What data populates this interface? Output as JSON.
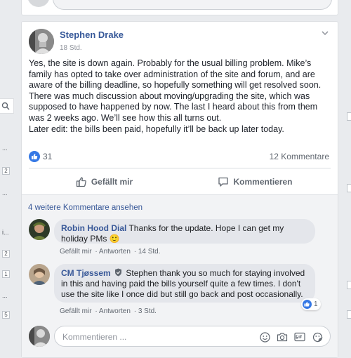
{
  "left_strip": {
    "badges": [
      "2",
      "2",
      "1",
      "5"
    ],
    "dots": [
      "...",
      "...",
      "...",
      "i..."
    ]
  },
  "post": {
    "author": "Stephen Drake",
    "timestamp": "18 Std.",
    "text_lines": [
      "Yes, the site is down again. Probably for the usual billing problem. Mike’s family has opted to take over administration of the site and forum, and are aware of the billing deadline, so hopefully something will get resolved soon. There was much discussion about moving/upgrading the site, which was supposed to have happened by now. The last I heard about this from them was 2 weeks ago. We’ll see how this all turns out.",
      "Later edit: the bills been paid, hopefully it’ll be back up later today."
    ],
    "like_count": "31",
    "comment_count": "12 Kommentare",
    "like_label": "Gefällt mir",
    "comment_label": "Kommentieren"
  },
  "comments_section": {
    "more_comments": "4 weitere Kommentare ansehen",
    "comments": [
      {
        "author": "Robin Hood Dial",
        "text": "Thanks for the update. Hope I can get my holiday PMs 🙂",
        "like": "Gefällt mir",
        "reply": "Antworten",
        "time": "14 Std."
      },
      {
        "author": "CM Tjøssem",
        "text": "Stephen thank you so much for staying involved in this and having paid the bills yourself quite a few times. I don't use the site like I once did but still go back and post occasionally.",
        "like": "Gefällt mir",
        "reply": "Antworten",
        "time": "3 Std.",
        "reaction_count": "1"
      }
    ],
    "composer_placeholder": "Kommentieren ..."
  },
  "colors": {
    "link": "#365899",
    "accent": "#3578e5",
    "background": "#e9ebee"
  }
}
